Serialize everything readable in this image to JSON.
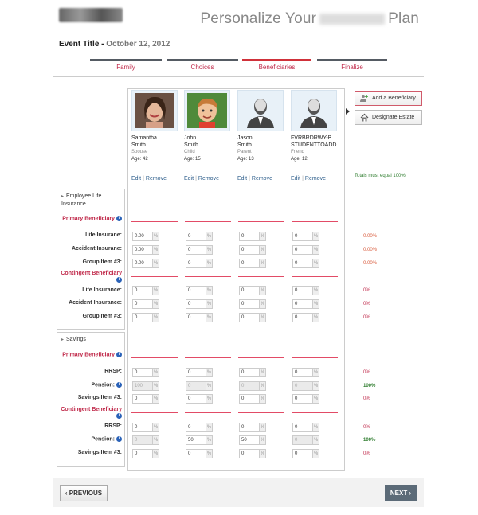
{
  "header": {
    "title_prefix": "Personalize Your",
    "title_suffix": "Plan",
    "event_title_label": "Event Title -",
    "event_date": "October 12, 2012"
  },
  "steps": [
    {
      "label": "Family",
      "active": false
    },
    {
      "label": "Choices",
      "active": false
    },
    {
      "label": "Beneficiaries",
      "active": true
    },
    {
      "label": "Finalize",
      "active": false
    }
  ],
  "beneficiaries": [
    {
      "first": "Samantha",
      "last": "Smith",
      "relation": "Spouse",
      "age": "Age: 42",
      "photo": "woman-photo"
    },
    {
      "first": "John",
      "last": "Smith",
      "relation": "Child",
      "age": "Age: 15",
      "photo": "boy-photo"
    },
    {
      "first": "Jason",
      "last": "Smith",
      "relation": "Parent",
      "age": "Age: 13",
      "photo": "silhouette"
    },
    {
      "first": "FVRBRDRWY-B...",
      "last": "STUDENTTOADD...",
      "relation": "Friend",
      "age": "Age: 12",
      "photo": "silhouette"
    }
  ],
  "actions": {
    "edit": "Edit",
    "remove": "Remove",
    "sep": "|"
  },
  "buttons": {
    "add_beneficiary": "Add a Beneficiary",
    "designate_estate": "Designate Estate",
    "previous": "‹ PREVIOUS",
    "next": "NEXT ›"
  },
  "totals_note": "Totals must equal 100%",
  "sections": {
    "life": "Employee Life Insurance",
    "savings": "Savings"
  },
  "labels": {
    "primary": "Primary Beneficiary",
    "contingent": "Contingent Beneficiary",
    "life_ins": "Life Insurane:",
    "accident_ins": "Accident Insurane:",
    "group_item": "Group Item #3:",
    "life_ins2": "Life Insurance:",
    "accident_ins2": "Accident Insurance:",
    "rrsp": "RRSP:",
    "pension": "Pension:",
    "savings_item": "Savings Item #3:"
  },
  "pct_symbol": "%",
  "rows": {
    "life_primary_life": [
      "0.00",
      "0",
      "0",
      "0"
    ],
    "life_primary_accident": [
      "0.00",
      "0",
      "0",
      "0"
    ],
    "life_primary_group": [
      "0.00",
      "0",
      "0",
      "0"
    ],
    "life_cont_life": [
      "0",
      "0",
      "0",
      "0"
    ],
    "life_cont_accident": [
      "0",
      "0",
      "0",
      "0"
    ],
    "life_cont_group": [
      "0",
      "0",
      "0",
      "0"
    ],
    "sav_primary_rrsp": [
      "0",
      "0",
      "0",
      "0"
    ],
    "sav_primary_pension": [
      "100",
      "0",
      "0",
      "0"
    ],
    "sav_primary_item": [
      "0",
      "0",
      "0",
      "0"
    ],
    "sav_cont_rrsp": [
      "0",
      "0",
      "0",
      "0"
    ],
    "sav_cont_pension": [
      "0",
      "50",
      "50",
      "0"
    ],
    "sav_cont_item": [
      "0",
      "0",
      "0",
      "0"
    ]
  },
  "totals": {
    "life_primary_life": "0.00%",
    "life_primary_accident": "0.00%",
    "life_primary_group": "0.00%",
    "life_cont_life": "0%",
    "life_cont_accident": "0%",
    "life_cont_group": "0%",
    "sav_primary_rrsp": "0%",
    "sav_primary_pension": "100%",
    "sav_primary_item": "0%",
    "sav_cont_rrsp": "0%",
    "sav_cont_pension": "100%",
    "sav_cont_item": "0%"
  },
  "colors": {
    "accent_red": "#d0313a",
    "label_red": "#c0294a",
    "total_green": "#2a7a2a",
    "info_blue": "#2a62b8"
  }
}
